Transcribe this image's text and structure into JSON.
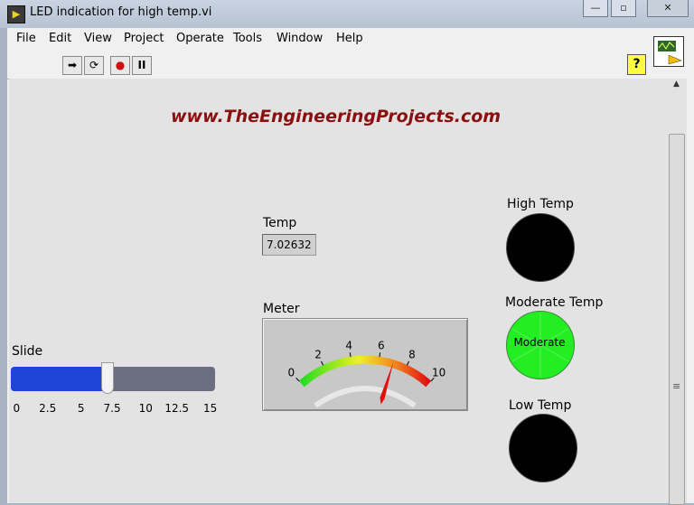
{
  "window": {
    "title": "LED indication for high temp.vi",
    "app_icon": "labview-icon",
    "min": "—",
    "restore": "▫",
    "close": "✕"
  },
  "menu": [
    "File",
    "Edit",
    "View",
    "Project",
    "Operate",
    "Tools",
    "Window",
    "Help"
  ],
  "toolbar": {
    "run": "➡",
    "run_continuous": "⟳",
    "abort": "●",
    "pause": "II",
    "help": "?"
  },
  "panel": {
    "website": "www.TheEngineeringProjects.com",
    "temp": {
      "label": "Temp",
      "value": "7.02632"
    },
    "meter": {
      "label": "Meter",
      "min": 0,
      "max": 10,
      "value": 7.02632,
      "ticks": [
        "0",
        "2",
        "4",
        "6",
        "8",
        "10"
      ]
    },
    "slide": {
      "label": "Slide",
      "min": 0,
      "max": 15,
      "value": 7.02632,
      "ticks": [
        "0",
        "2.5",
        "5",
        "7.5",
        "10",
        "12.5",
        "15"
      ]
    },
    "leds": {
      "high": {
        "label": "High Temp",
        "on": false
      },
      "moderate": {
        "label": "Moderate Temp",
        "on": true,
        "text": "Moderate"
      },
      "low": {
        "label": "Low Temp",
        "on": false
      }
    }
  },
  "colors": {
    "led_on": "#22ee22",
    "led_off": "#000000",
    "slide_fill": "#1f45d6",
    "website": "#8b0f0f"
  }
}
